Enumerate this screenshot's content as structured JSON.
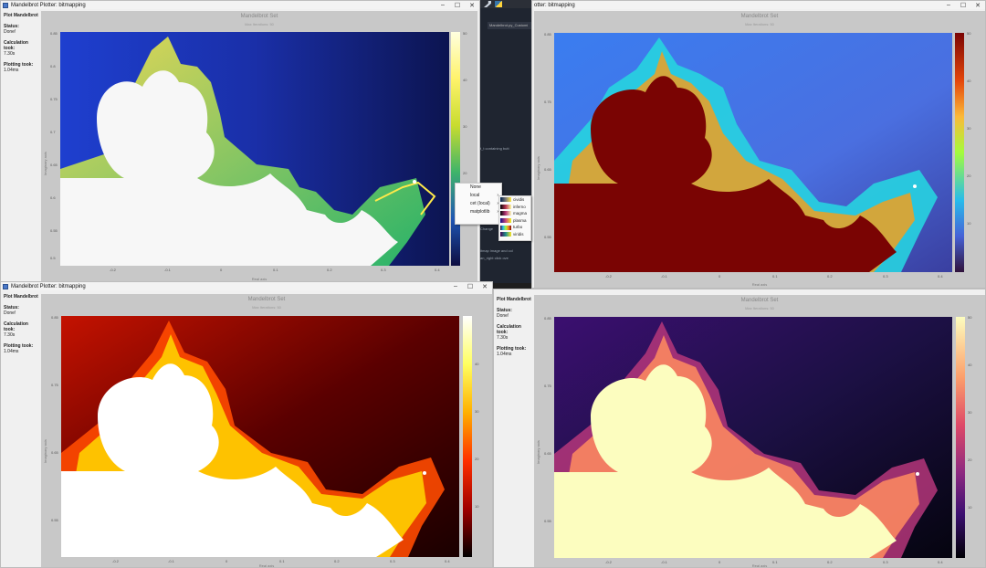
{
  "windows": {
    "tl": {
      "title": "Mandelbrot Plotter: bitmapping",
      "sidebar": {
        "plot_label": "Plot Mandelbrot",
        "status_label": "Status:",
        "status_value": "Done!",
        "calc_label": "Calculation took:",
        "calc_value": "7.30s",
        "plot_time_label": "Plotting took:",
        "plot_time_value": "1.04ms"
      },
      "plot": {
        "title": "Mandelbrot Set",
        "subtitle": "Max Iterations: 50",
        "xlabel": "Real axis",
        "ylabel": "Imaginary axis",
        "colormap": "viridis-like (blue/yellow)"
      }
    },
    "tr": {
      "title": "otter: bitmapping",
      "plot": {
        "title": "Mandelbrot Set",
        "subtitle": "Max Iterations: 50",
        "xlabel": "Real axis",
        "ylabel": "Imaginary axis",
        "colormap": "turbo"
      }
    },
    "bl": {
      "title": "Mandelbrot Plotter: bitmapping",
      "sidebar": {
        "plot_label": "Plot Mandelbrot",
        "status_label": "Status:",
        "status_value": "Done!",
        "calc_label": "Calculation took:",
        "calc_value": "7.30s",
        "plot_time_label": "Plotting took:",
        "plot_time_value": "1.04ms"
      },
      "plot": {
        "title": "Mandelbrot Set",
        "subtitle": "Max Iterations: 50",
        "xlabel": "Real axis",
        "ylabel": "Imaginary axis",
        "colormap": "hot"
      }
    },
    "br": {
      "sidebar": {
        "plot_label": "Plot Mandelbrot",
        "status_label": "Status:",
        "status_value": "Done!",
        "calc_label": "Calculation took:",
        "calc_value": "7.30s",
        "plot_time_label": "Plotting took:",
        "plot_time_value": "1.04ms"
      },
      "plot": {
        "title": "Mandelbrot Set",
        "subtitle": "Max Iterations: 50",
        "xlabel": "Real axis",
        "ylabel": "Imaginary axis",
        "colormap": "magma"
      }
    }
  },
  "x_ticks": [
    "-0.2",
    "-0.1",
    "0",
    "0.1",
    "0.2",
    "0.3",
    "0.4"
  ],
  "y_ticks": [
    "0.85",
    "0.8",
    "0.75",
    "0.7",
    "0.65",
    "0.6",
    "0.55",
    "0.5"
  ],
  "cbar_ticks": [
    "50",
    "40",
    "30",
    "20",
    "10"
  ],
  "editor": {
    "tab_label": "Mandelbrot.py_Customi",
    "code_line1": "t_t containing butt",
    "code_line2": "itmap image and col",
    "code_line3": "an_right click ove",
    "code_line4": "Change"
  },
  "context_menu": {
    "items": [
      {
        "label": "None",
        "has_sub": false
      },
      {
        "label": "local",
        "has_sub": true
      },
      {
        "label": "cet (local)",
        "has_sub": true
      },
      {
        "label": "matplotlib",
        "has_sub": true
      }
    ],
    "submenu": [
      {
        "label": "cividis",
        "c1": "#00204c",
        "c2": "#ffe945"
      },
      {
        "label": "inferno",
        "c1": "#000004",
        "c2": "#fcffa4"
      },
      {
        "label": "magma",
        "c1": "#000004",
        "c2": "#fcfdbf"
      },
      {
        "label": "plasma",
        "c1": "#0d0887",
        "c2": "#f0f921"
      },
      {
        "label": "turbo",
        "c1": "#30123b",
        "c2": "#7a0403"
      },
      {
        "label": "viridis",
        "c1": "#440154",
        "c2": "#fde725"
      }
    ]
  },
  "window_buttons": {
    "min": "–",
    "max": "☐",
    "close": "✕"
  }
}
